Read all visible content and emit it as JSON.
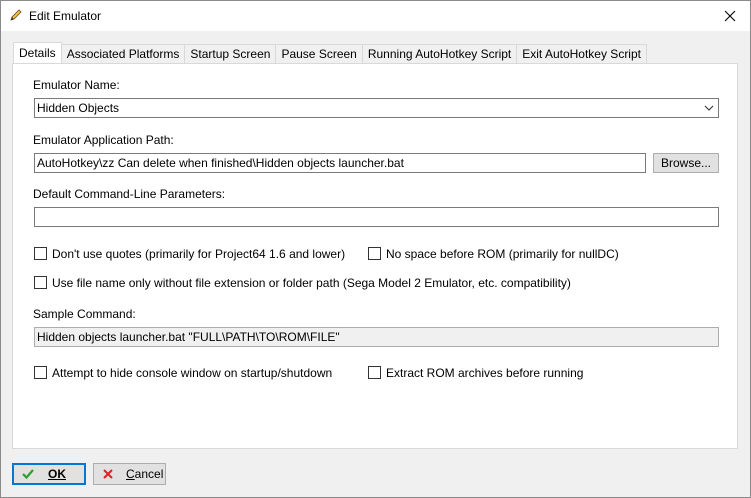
{
  "window": {
    "title": "Edit Emulator"
  },
  "tabs": [
    {
      "label": "Details",
      "active": true
    },
    {
      "label": "Associated Platforms",
      "active": false
    },
    {
      "label": "Startup Screen",
      "active": false
    },
    {
      "label": "Pause Screen",
      "active": false
    },
    {
      "label": "Running AutoHotkey Script",
      "active": false
    },
    {
      "label": "Exit AutoHotkey Script",
      "active": false
    }
  ],
  "details": {
    "emulator_name_label": "Emulator Name:",
    "emulator_name_value": "Hidden Objects",
    "app_path_label": "Emulator Application Path:",
    "app_path_value": "AutoHotkey\\zz Can delete when finished\\Hidden objects launcher.bat",
    "browse_label": "Browse...",
    "cmd_params_label": "Default Command-Line Parameters:",
    "cmd_params_value": "",
    "no_quotes_label": "Don't use quotes (primarily for Project64 1.6 and lower)",
    "no_quotes_checked": false,
    "no_space_label": "No space before ROM (primarily for nullDC)",
    "no_space_checked": false,
    "filename_only_label": "Use file name only without file extension or folder path (Sega Model 2 Emulator, etc. compatibility)",
    "filename_only_checked": false,
    "sample_command_label": "Sample Command:",
    "sample_command_value": "Hidden objects launcher.bat \"FULL\\PATH\\TO\\ROM\\FILE\"",
    "hide_console_label": "Attempt to hide console window on startup/shutdown",
    "hide_console_checked": false,
    "extract_rom_label": "Extract ROM archives before running",
    "extract_rom_checked": false
  },
  "footer": {
    "ok_label": "OK",
    "cancel_label": "Cancel"
  },
  "colors": {
    "accent": "#0078d7",
    "ok_icon": "#2e9e2e",
    "cancel_icon": "#d22"
  }
}
